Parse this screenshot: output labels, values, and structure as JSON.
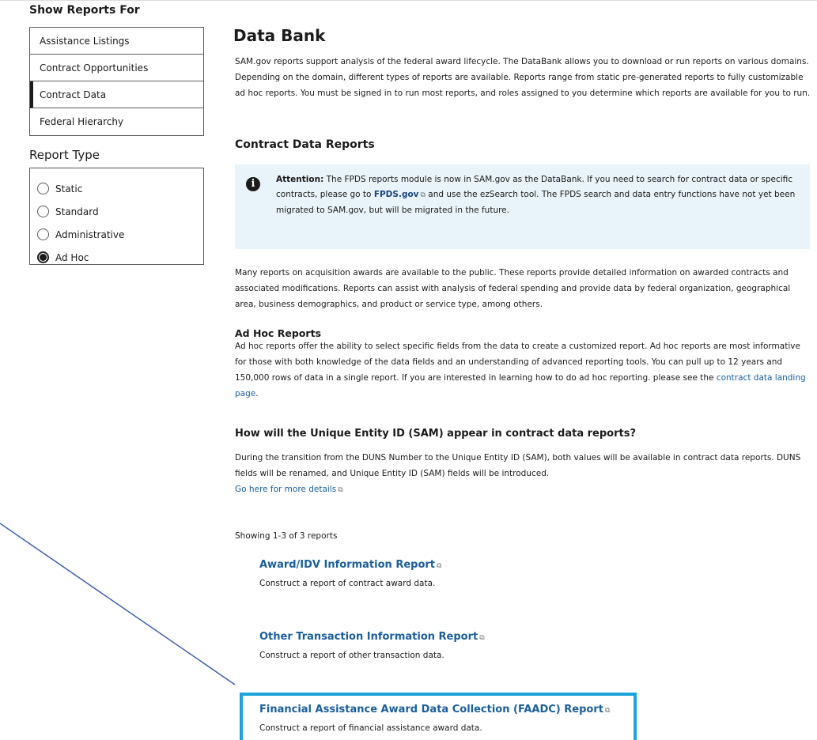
{
  "sidebar": {
    "show_heading": "Show Reports For",
    "filters": [
      {
        "label": "Assistance Listings"
      },
      {
        "label": "Contract Opportunities"
      },
      {
        "label": "Contract Data"
      },
      {
        "label": "Federal Hierarchy"
      }
    ],
    "active_filter": "Contract Data",
    "report_type_heading": "Report Type",
    "report_types": [
      {
        "label": "Static",
        "checked": false
      },
      {
        "label": "Standard",
        "checked": false
      },
      {
        "label": "Administrative",
        "checked": false
      },
      {
        "label": "Ad Hoc",
        "checked": true
      }
    ]
  },
  "main": {
    "title": "Data Bank",
    "intro": "SAM.gov reports support analysis of the federal award lifecycle. The DataBank allows you to download or run reports on various domains. Depending on the domain, different types of reports are available. Reports range from static pre-generated reports to fully customizable ad hoc reports. You must be signed in to run most reports, and roles assigned to you determine which reports are available for you to run.",
    "section_heading": "Contract Data Reports",
    "alert": {
      "icon": "info-icon",
      "label": "Attention:",
      "text_before_link": " The FPDS reports module is now in SAM.gov as the DataBank. If you need to search for contract data or specific contracts, please go to ",
      "link": "FPDS.gov",
      "text_after_link": " and use the ezSearch tool. The FPDS search and data entry functions have not yet been migrated to SAM.gov, but will be migrated in the future."
    },
    "public_info": "Many reports on acquisition awards are available to the public. These reports provide detailed information on awarded contracts and associated modifications. Reports can assist with analysis of federal spending and provide data by federal organization, geographical area, business demographics, and product or service type, among others.",
    "adhoc": {
      "heading": "Ad Hoc Reports",
      "text": "Ad hoc reports offer the ability to select specific fields from the data to create a customized report. Ad hoc reports are most informative for those with both knowledge of the data fields and an understanding of advanced reporting tools. You can pull up to 12 years and 150,000 rows of data in a single report. If you are interested in learning how to do ad hoc reporting. please see the ",
      "link": "contract data landing page",
      "after": "."
    },
    "uei": {
      "heading": "How will the Unique Entity ID (SAM) appear in contract data reports?",
      "text": "During the transition from the DUNS Number to the Unique Entity ID (SAM), both values will be available in contract data reports. DUNS fields will be renamed, and Unique Entity ID (SAM) fields will be introduced.",
      "link": "Go here for more details"
    },
    "showing": "Showing 1-3 of 3 reports",
    "reports": [
      {
        "title": "Award/IDV Information Report",
        "desc": "Construct a report of contract award data."
      },
      {
        "title": "Other Transaction Information Report",
        "desc": "Construct a report of other transaction data."
      },
      {
        "title": "Financial Assistance Award Data Collection (FAADC) Report",
        "desc": "Construct a report of financial assistance award data."
      }
    ]
  },
  "colors": {
    "link": "#1a5e9c",
    "alert_bg": "#e8f4f9",
    "highlight": "#1ca2dc",
    "annotation_line": "#3f5fb5"
  }
}
